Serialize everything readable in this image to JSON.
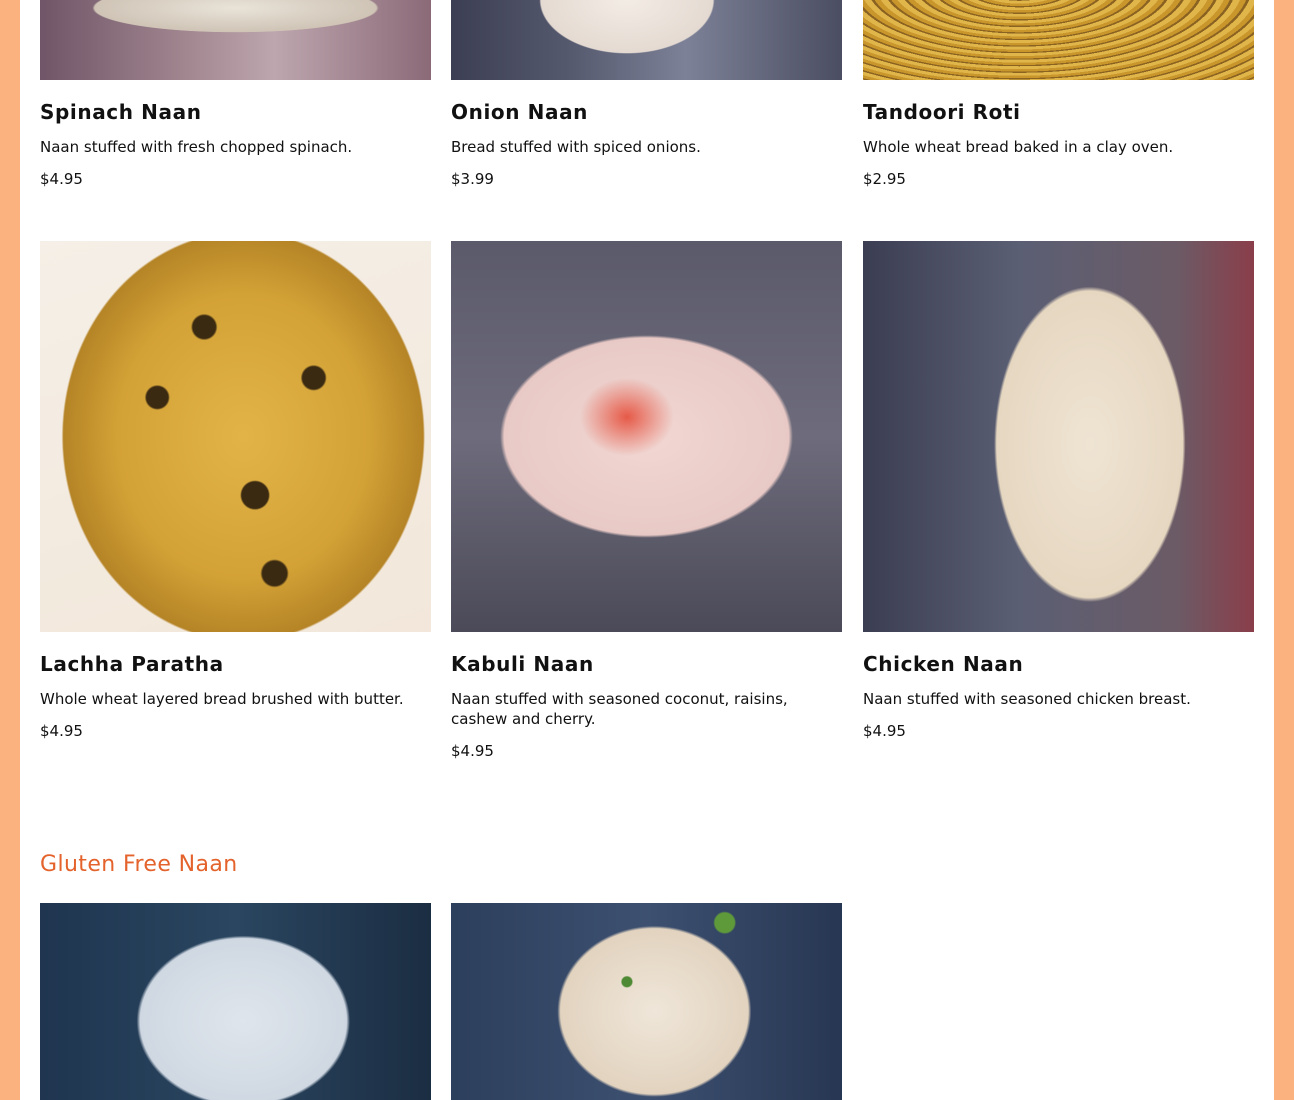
{
  "items_row1": [
    {
      "name": "Spinach Naan",
      "description": "Naan stuffed with fresh chopped spinach.",
      "price": "$4.95"
    },
    {
      "name": "Onion Naan",
      "description": "Bread stuffed with spiced onions.",
      "price": "$3.99"
    },
    {
      "name": "Tandoori Roti",
      "description": "Whole wheat bread baked in a clay oven.",
      "price": "$2.95"
    }
  ],
  "items_row2": [
    {
      "name": "Lachha Paratha",
      "description": "Whole wheat layered bread brushed with butter.",
      "price": "$4.95"
    },
    {
      "name": "Kabuli Naan",
      "description": "Naan stuffed with seasoned coconut, raisins, cashew and cherry.",
      "price": "$4.95"
    },
    {
      "name": "Chicken Naan",
      "description": "Naan stuffed with seasoned chicken breast.",
      "price": "$4.95"
    }
  ],
  "sections": {
    "gluten_free_title": "Gluten Free Naan"
  },
  "colors": {
    "page_border": "#fcb27f",
    "section_title": "#e4622b"
  }
}
